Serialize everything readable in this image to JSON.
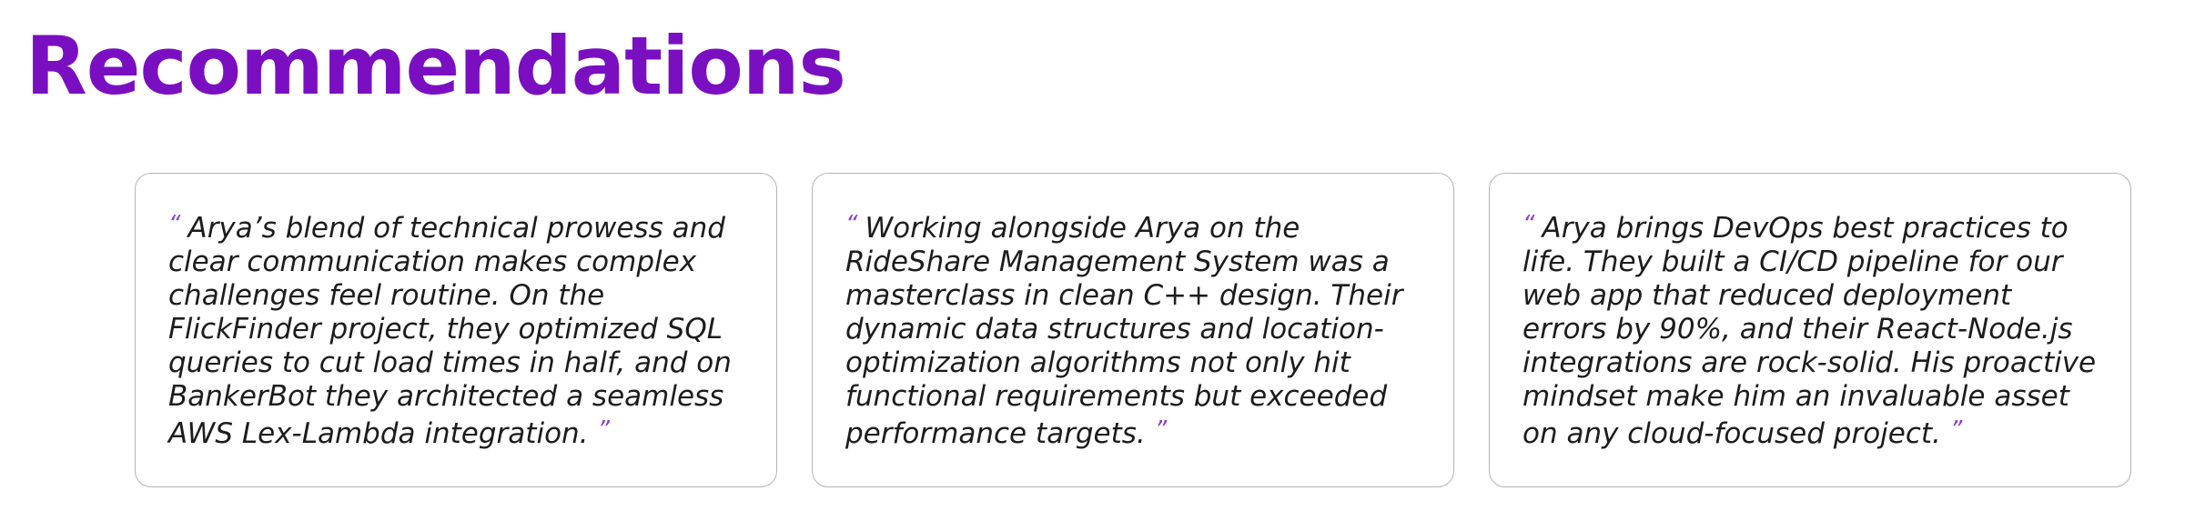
{
  "section": {
    "title": "Recommendations"
  },
  "colors": {
    "accent": "#7a0fc2",
    "quote_mark": "#8a3fd1",
    "card_border": "#b4b4b4",
    "text": "#1c1c1c"
  },
  "quote_marks": {
    "open": "“",
    "close": "”"
  },
  "recommendations": [
    {
      "text": "Arya’s blend of technical prowess and clear communication makes complex challenges feel routine. On the FlickFinder project, they optimized SQL queries to cut load times in half, and on BankerBot they architected a seamless AWS Lex-Lambda integration."
    },
    {
      "text": "Working alongside Arya on the RideShare Management System was a masterclass in clean C++ design. Their dynamic data structures and location-optimization algorithms not only hit functional requirements but exceeded performance targets."
    },
    {
      "text": "Arya brings DevOps best practices to life. They built a CI/CD pipeline for our web app that reduced deployment errors by 90%, and their React-Node.js integrations are rock-solid. His proactive mindset make him an invaluable asset on any cloud-focused project."
    }
  ]
}
